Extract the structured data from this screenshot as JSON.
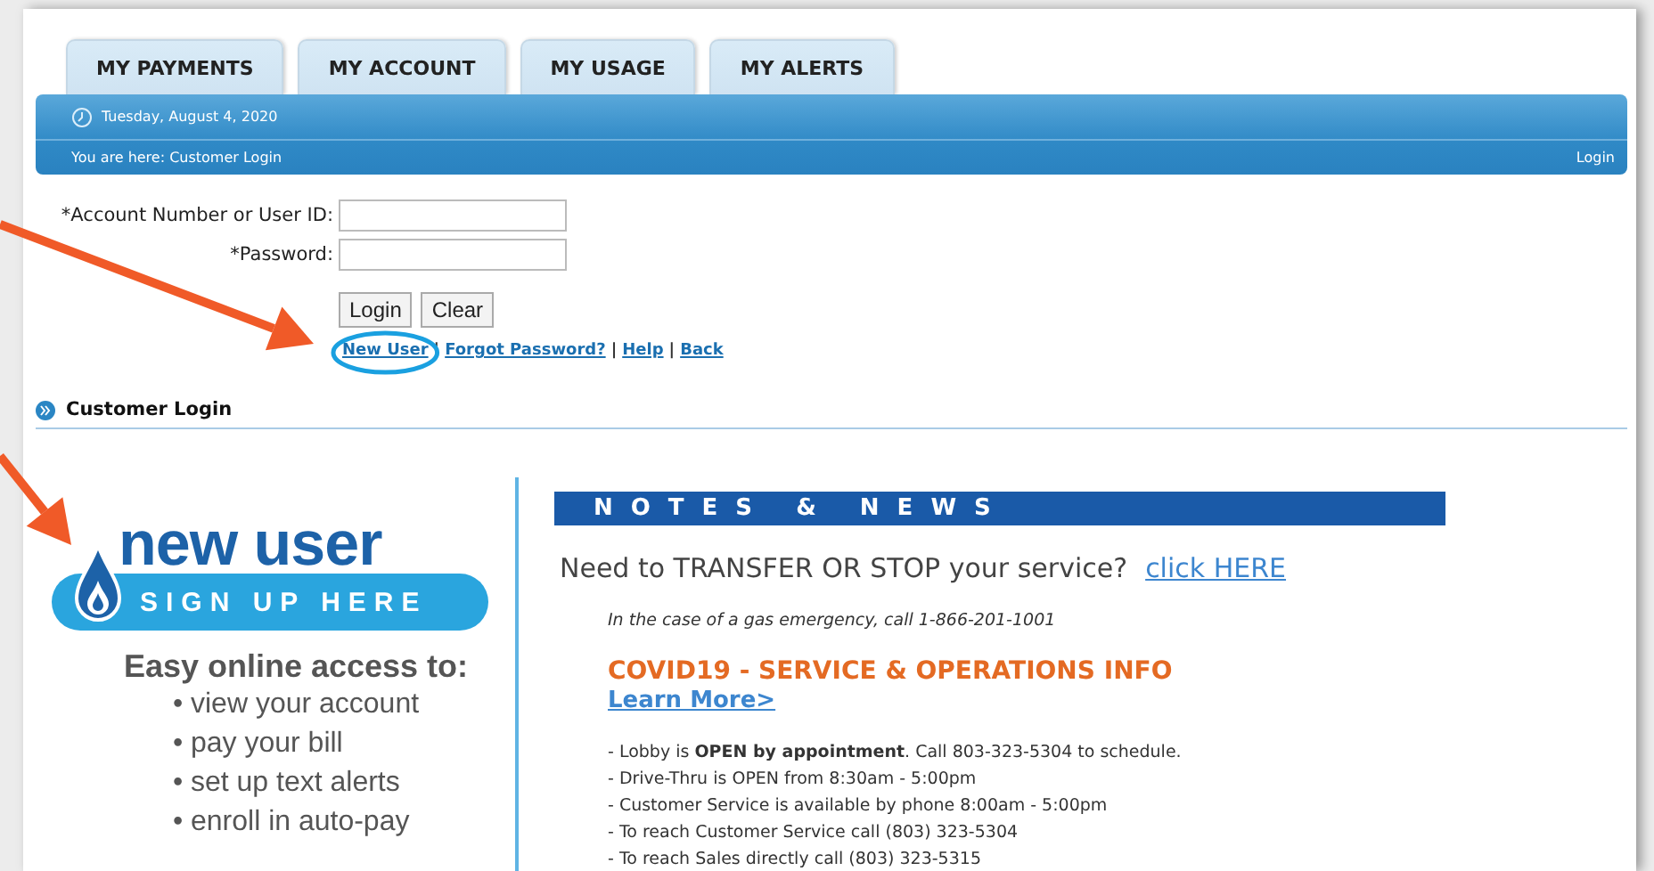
{
  "tabs": [
    {
      "label": "MY PAYMENTS",
      "selected": false
    },
    {
      "label": "MY ACCOUNT",
      "selected": false
    },
    {
      "label": "MY USAGE",
      "selected": false
    },
    {
      "label": "MY ALERTS",
      "selected": false
    }
  ],
  "header_bar": {
    "date": "Tuesday, August 4, 2020",
    "breadcrumb": "You are here:  Customer Login",
    "login_link": "Login"
  },
  "login_form": {
    "fields": [
      {
        "label": "*Account Number or User ID:"
      },
      {
        "label": "*Password:"
      }
    ],
    "buttons": [
      "Login",
      "Clear"
    ],
    "links": [
      "New User",
      "Forgot Password?",
      "Help",
      "Back"
    ],
    "separator": "|"
  },
  "section_title": "Customer Login",
  "promo": {
    "title": "new user",
    "subtitle": "SIGN UP HERE",
    "heading": "Easy online access to:",
    "items": [
      "• view your account",
      "• pay your bill",
      "• set up text alerts",
      "• enroll in auto-pay"
    ]
  },
  "news": {
    "title": "NOTES & NEWS",
    "transfer_text": "Need to TRANSFER OR STOP your service?",
    "transfer_link": "click HERE",
    "emergency": "In the case of a gas emergency, call 1-866-201-1001",
    "covid_title": "COVID19 -  SERVICE & OPERATIONS INFO",
    "covid_link": "Learn More>",
    "notes": [
      "- Lobby is **OPEN by appointment**.  Call 803-323-5304 to schedule.",
      "- Drive-Thru is OPEN from 8:30am - 5:00pm",
      "- Customer Service is available by phone 8:00am - 5:00pm",
      "- To reach Customer Service call (803) 323-5304",
      "- To reach Sales directly call (803) 323-5315"
    ]
  },
  "annotations": [
    {
      "kind": "arrow"
    },
    {
      "kind": "arrow"
    },
    {
      "kind": "circle"
    }
  ]
}
